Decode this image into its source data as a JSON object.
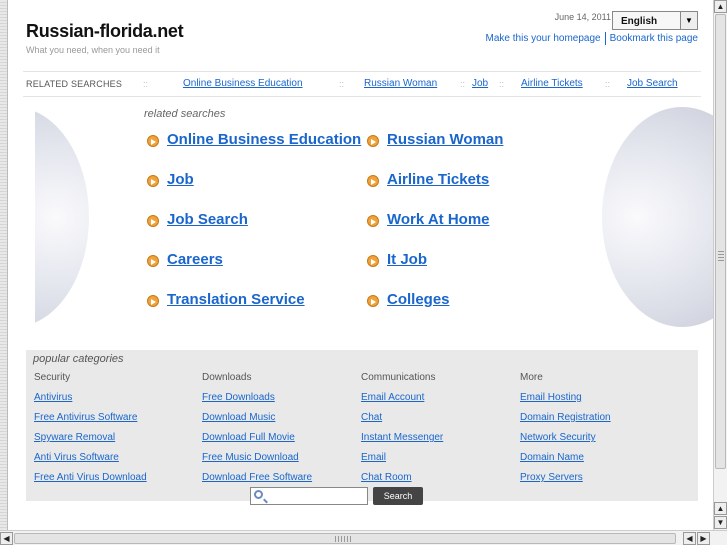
{
  "header": {
    "site_title": "Russian-florida.net",
    "tagline": "What you need, when you need it",
    "date": "June 14, 2011",
    "language": "English",
    "homepage_link": "Make this your homepage",
    "bookmark_link": "Bookmark this page"
  },
  "related_bar": {
    "label": "RELATED SEARCHES",
    "separator": "::",
    "links": [
      "Online Business Education",
      "Russian Woman",
      "Job",
      "Airline Tickets",
      "Job Search"
    ]
  },
  "related_searches": {
    "heading": "related searches",
    "items": [
      "Online Business Education",
      "Russian Woman",
      "Job",
      "Airline Tickets",
      "Job Search",
      "Work At Home",
      "Careers",
      "It Job",
      "Translation Service",
      "Colleges"
    ]
  },
  "popular": {
    "heading": "popular categories",
    "columns": [
      {
        "title": "Security",
        "links": [
          "Antivirus",
          "Free Antivirus Software",
          "Spyware Removal",
          "Anti Virus Software",
          "Free Anti Virus Download"
        ]
      },
      {
        "title": "Downloads",
        "links": [
          "Free Downloads",
          "Download Music",
          "Download Full Movie",
          "Free Music Download",
          "Download Free Software"
        ]
      },
      {
        "title": "Communications",
        "links": [
          "Email Account",
          "Chat",
          "Instant Messenger",
          "Email",
          "Chat Room"
        ]
      },
      {
        "title": "More",
        "links": [
          "Email Hosting",
          "Domain Registration",
          "Network Security",
          "Domain Name",
          "Proxy Servers"
        ]
      }
    ]
  },
  "search": {
    "placeholder": "",
    "button": "Search"
  },
  "icons": {
    "arrow": "arrow-circle-icon",
    "search": "search-icon",
    "dropdown": "chevron-down-icon"
  },
  "colors": {
    "link": "#1a66cc",
    "arrow": "#f0a33a",
    "panel": "#e9e9e9"
  }
}
